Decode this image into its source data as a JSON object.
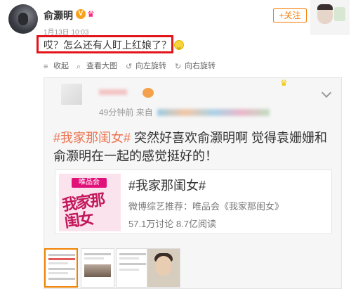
{
  "post": {
    "username": "俞灏明",
    "verified_badge": "V",
    "timestamp": "1月13日 10:03",
    "text": "哎？怎么还有人盯上红娘了？",
    "follow_button": "+关注",
    "highlight_color": "#e3151b",
    "accent_color": "#f77b00"
  },
  "toolbar": {
    "items": [
      {
        "label": "收起",
        "icon": "collapse-icon"
      },
      {
        "label": "查看大图",
        "icon": "zoom-icon"
      },
      {
        "label": "向左旋转",
        "icon": "rotate-left-icon"
      },
      {
        "label": "向右旋转",
        "icon": "rotate-right-icon"
      }
    ]
  },
  "card": {
    "meta_time": "49分钟前",
    "meta_from": "来自",
    "text_tag": "#我家那闺女#",
    "text_body": " 突然好喜欢俞灏明啊 觉得袁姗姗和俞灏明在一起的感觉挺好的！",
    "link": {
      "thumb_logo": "唯品会",
      "thumb_text": "我家那闺女",
      "title": "#我家那闺女#",
      "description": "微博综艺推荐：唯品会《我家那闺女》",
      "stats": "57.1万讨论    8.7亿阅读"
    }
  }
}
